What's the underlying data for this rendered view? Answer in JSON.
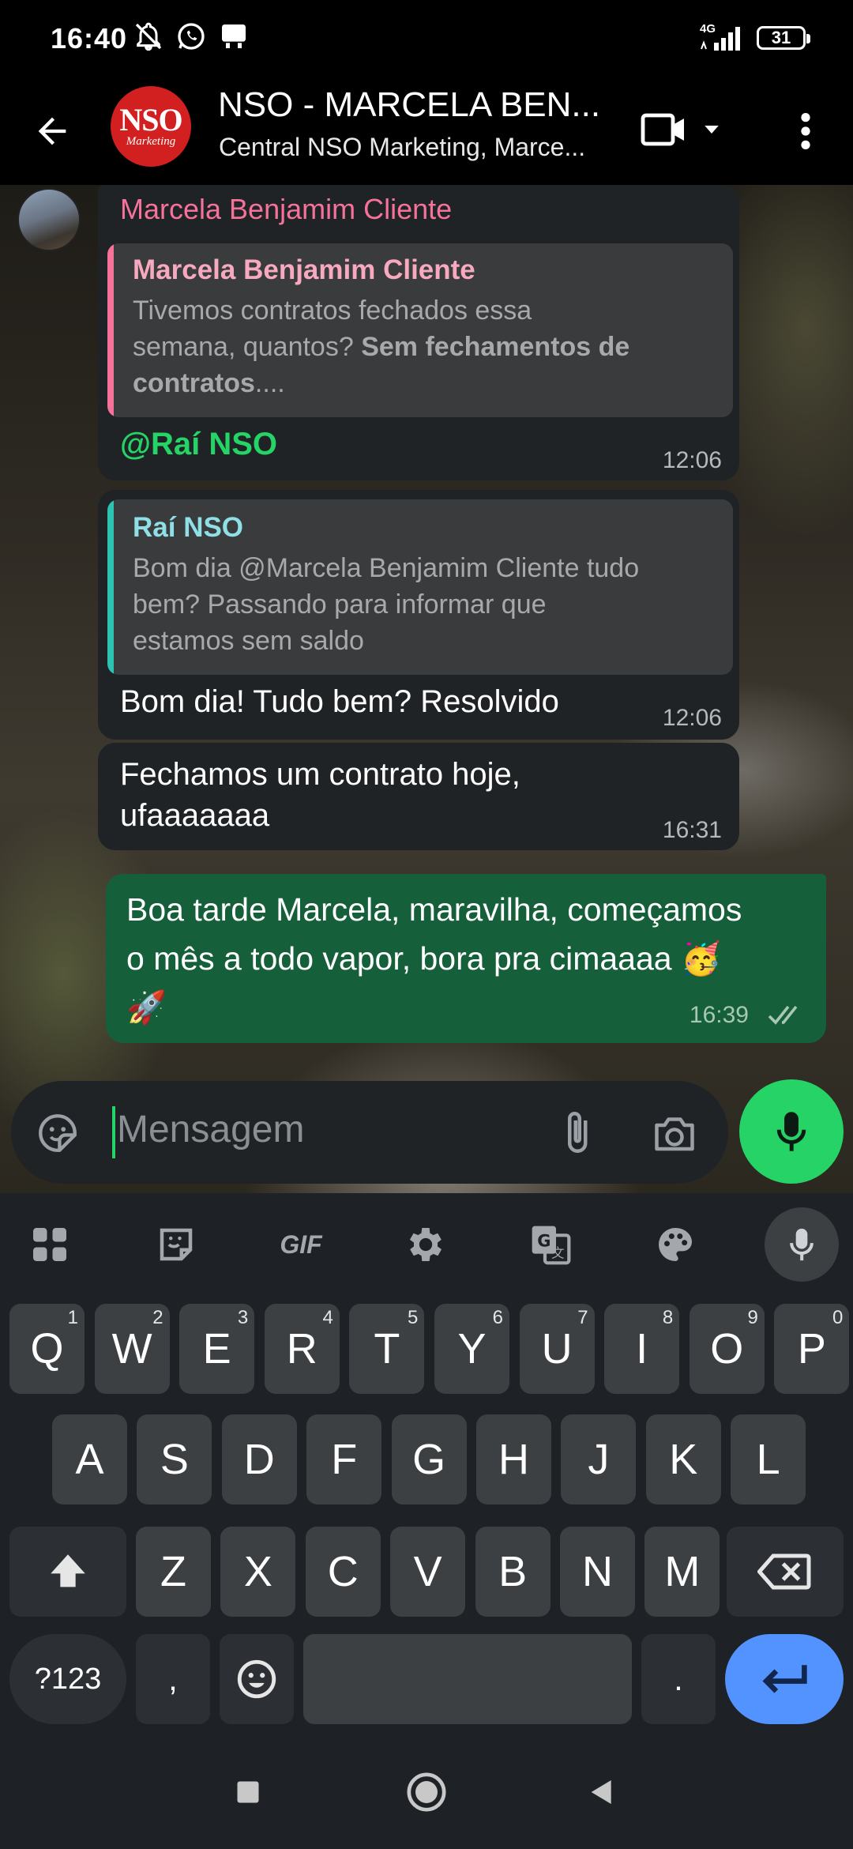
{
  "status_bar": {
    "time": "16:40",
    "network": "4G",
    "battery": "31"
  },
  "header": {
    "title": "NSO - MARCELA BEN...",
    "subtitle": "Central NSO Marketing, Marce...",
    "avatar_logo_big": "NSO",
    "avatar_logo_small": "Marketing"
  },
  "messages": [
    {
      "sender": "Marcela Benjamim Cliente",
      "quote_name": "Marcela Benjamim Cliente",
      "quote_line1": "Tivemos contratos fechados essa",
      "quote_line2_normal": "semana, quantos? ",
      "quote_line2_bold": "Sem fechamentos de",
      "quote_line3_bold": "contratos",
      "quote_line3_normal": "....",
      "text": "@Raí NSO",
      "time": "12:06"
    },
    {
      "quote_name": "Raí NSO",
      "quote_line1": "Bom dia @Marcela Benjamim Cliente tudo",
      "quote_line2": "bem? Passando para informar que",
      "quote_line3": "estamos sem saldo",
      "text": "Bom dia! Tudo bem? Resolvido",
      "time": "12:06"
    },
    {
      "line1": "Fechamos um contrato hoje,",
      "line2": "ufaaaaaaa",
      "time": "16:31"
    },
    {
      "line1": "Boa tarde Marcela, maravilha, começamos",
      "line2": "o mês a todo vapor, bora pra cimaaaa 🥳",
      "line3": "🚀",
      "time": "16:39"
    }
  ],
  "composer": {
    "placeholder": "Mensagem"
  },
  "keyboard": {
    "toolbar": {
      "gif": "GIF"
    },
    "row1": [
      {
        "k": "Q",
        "h": "1"
      },
      {
        "k": "W",
        "h": "2"
      },
      {
        "k": "E",
        "h": "3"
      },
      {
        "k": "R",
        "h": "4"
      },
      {
        "k": "T",
        "h": "5"
      },
      {
        "k": "Y",
        "h": "6"
      },
      {
        "k": "U",
        "h": "7"
      },
      {
        "k": "I",
        "h": "8"
      },
      {
        "k": "O",
        "h": "9"
      },
      {
        "k": "P",
        "h": "0"
      }
    ],
    "row2": [
      "A",
      "S",
      "D",
      "F",
      "G",
      "H",
      "J",
      "K",
      "L"
    ],
    "row3": [
      "Z",
      "X",
      "C",
      "V",
      "B",
      "N",
      "M"
    ],
    "symbols": "?123",
    "comma": ",",
    "period": "."
  }
}
